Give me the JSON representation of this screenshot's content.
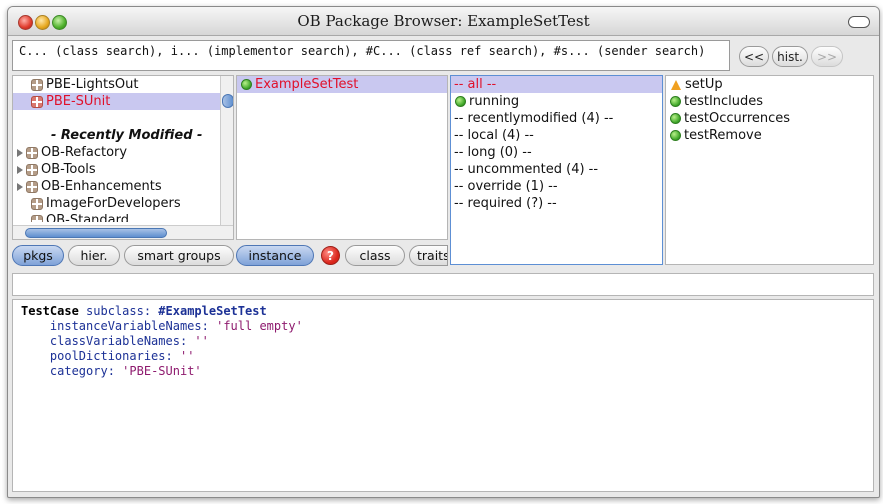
{
  "window": {
    "title": "OB Package Browser: ExampleSetTest"
  },
  "search": {
    "text": "C... (class search), i... (implementor search), #C... (class ref search), #s... (sender search)"
  },
  "nav": {
    "back": "<<",
    "history": "hist.",
    "forward": ">>"
  },
  "packages": {
    "items": [
      {
        "label": "PBE-LightsOut"
      },
      {
        "label": "PBE-SUnit"
      },
      {
        "label": "- Recently Modified -"
      },
      {
        "label": "OB-Refactory"
      },
      {
        "label": "OB-Tools"
      },
      {
        "label": "OB-Enhancements"
      },
      {
        "label": "ImageForDevelopers"
      },
      {
        "label": "OB-Standard"
      }
    ]
  },
  "classes": {
    "items": [
      {
        "label": "ExampleSetTest"
      }
    ]
  },
  "categories": {
    "items": [
      {
        "label": "-- all --"
      },
      {
        "label": "running"
      },
      {
        "label": "-- recentlymodified (4) --"
      },
      {
        "label": "-- local (4) --"
      },
      {
        "label": "-- long (0) --"
      },
      {
        "label": "-- uncommented (4) --"
      },
      {
        "label": "-- override (1) --"
      },
      {
        "label": "-- required (?) --"
      }
    ]
  },
  "methods": {
    "items": [
      {
        "label": "setUp",
        "icon": "warning-icon"
      },
      {
        "label": "testIncludes",
        "icon": "green-dot-icon"
      },
      {
        "label": "testOccurrences",
        "icon": "green-dot-icon"
      },
      {
        "label": "testRemove",
        "icon": "green-dot-icon"
      }
    ]
  },
  "toggles": {
    "pkgs": "pkgs",
    "hier": "hier.",
    "smart_groups": "smart groups",
    "instance": "instance",
    "help": "?",
    "class": "class",
    "traits": "traits"
  },
  "code": {
    "line1_super": "TestCase",
    "line1_msg": "subclass:",
    "line1_sym": "#ExampleSetTest",
    "line2_msg": "instanceVariableNames:",
    "line2_str": "'full empty'",
    "line3_msg": "classVariableNames:",
    "line3_str": "''",
    "line4_msg": "poolDictionaries:",
    "line4_str": "''",
    "line5_msg": "category:",
    "line5_str": "'PBE-SUnit'"
  }
}
